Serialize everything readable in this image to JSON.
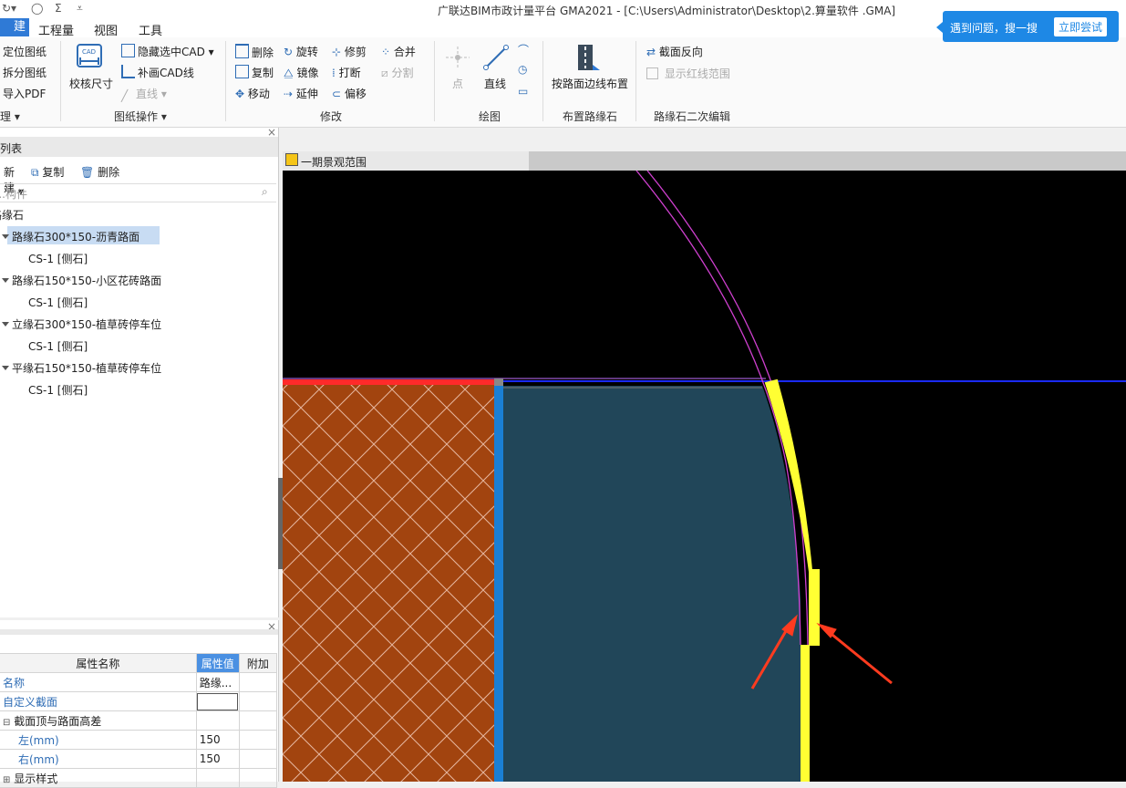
{
  "window": {
    "title": "广联达BIM市政计量平台 GMA2021 - [C:\\Users\\Administrator\\Desktop\\2.算量软件 .GMA]"
  },
  "menu": {
    "active": "建模",
    "items": [
      "工程量",
      "视图",
      "工具"
    ]
  },
  "ribbon": {
    "cad_group": {
      "b1": "定位图纸",
      "b2": "拆分图纸",
      "b3": "导入PDF",
      "label": "理"
    },
    "drawing_ops": {
      "check_size": "校核尺寸",
      "hide_cad": "隐藏选中CAD",
      "add_cad_line": "补画CAD线",
      "line": "直线",
      "label": "图纸操作"
    },
    "modify": {
      "delete": "删除",
      "rotate": "旋转",
      "trim": "修剪",
      "merge": "合并",
      "copy": "复制",
      "mirror": "镜像",
      "break": "打断",
      "split": "分割",
      "move": "移动",
      "extend": "延伸",
      "offset": "偏移",
      "label": "修改"
    },
    "draw": {
      "point": "点",
      "line": "直线",
      "label": "绘图"
    },
    "curb_layout": {
      "by_edge": "按路面边线布置",
      "label": "布置路缘石"
    },
    "curb_edit": {
      "reverse": "截面反向",
      "show_red": "显示红线范围",
      "label": "路缘石二次编辑"
    }
  },
  "help": {
    "text": "遇到问题，搜一搜",
    "button": "立即尝试"
  },
  "component_list": {
    "title": "列表",
    "new": "新建",
    "copy": "复制",
    "delete": "删除",
    "search_placeholder": "构件...",
    "root": "路缘石",
    "items": [
      {
        "name": "路缘石300*150-沥青路面",
        "child": "CS-1 [侧石]"
      },
      {
        "name": "路缘石150*150-小区花砖路面",
        "child": "CS-1 [侧石]"
      },
      {
        "name": "立缘石300*150-植草砖停车位",
        "child": "CS-1 [侧石]"
      },
      {
        "name": "平缘石150*150-植草砖停车位",
        "child": "CS-1 [侧石]"
      }
    ]
  },
  "properties": {
    "headers": {
      "name": "属性名称",
      "value": "属性值",
      "extra": "附加"
    },
    "rows": [
      {
        "name": "名称",
        "value": "路缘..."
      },
      {
        "name": "自定义截面",
        "value": ""
      },
      {
        "name": "截面顶与路面高差",
        "value": ""
      },
      {
        "name": "左(mm)",
        "value": "150"
      },
      {
        "name": "右(mm)",
        "value": "150"
      },
      {
        "name": "显示样式",
        "value": ""
      }
    ]
  },
  "canvas": {
    "tab": "一期景观范围"
  }
}
